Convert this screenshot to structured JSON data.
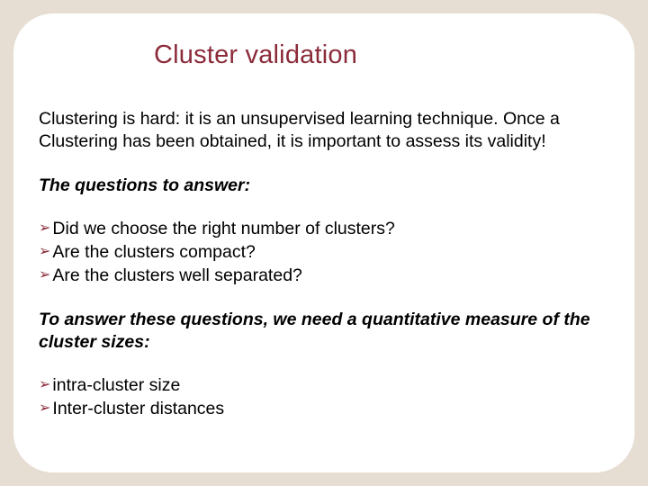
{
  "title": "Cluster validation",
  "intro": "Clustering is hard: it is an unsupervised learning technique. Once a Clustering has been obtained, it is important to assess its validity!",
  "sub1": "The questions to answer:",
  "questions": [
    "Did we choose the right number of clusters?",
    "Are the clusters compact?",
    "Are the clusters well separated?"
  ],
  "sub2": "To answer these questions, we need a quantitative measure  of the cluster sizes:",
  "measures": [
    "intra-cluster size",
    "Inter-cluster distances"
  ],
  "bullet_glyph": "➢"
}
